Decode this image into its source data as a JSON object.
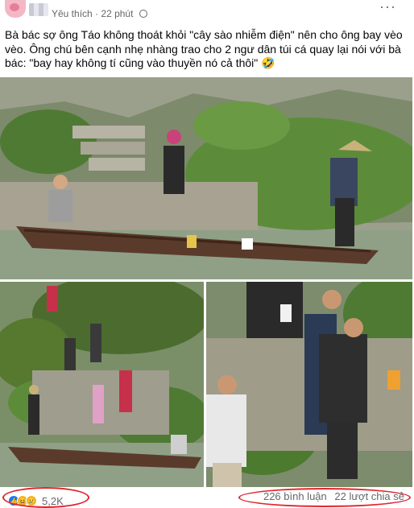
{
  "post": {
    "author_snippet": "Yêu thích",
    "time": "22 phút",
    "more_label": "···",
    "caption_line1": "Bà bác sợ ông Táo không thoát khỏi \"cây sào nhiễm điện\" nên cho ông bay vèo vèo. Ông chú bên cạnh nhẹ nhàng trao cho 2 ngư dân túi cá quay lại nói với bà bác: \"bay hay không tí cũng vào thuyền nó cả thôi\" 🤣"
  },
  "footer": {
    "reaction_count": "5,2K",
    "comments": "226 bình luận",
    "shares": "22 lượt chia sẻ",
    "reactions": [
      "like-icon",
      "haha-icon",
      "sad-icon"
    ]
  },
  "colors": {
    "accent_red": "#e0262d",
    "like_blue": "#1877f2",
    "muted_text": "#65676b"
  }
}
